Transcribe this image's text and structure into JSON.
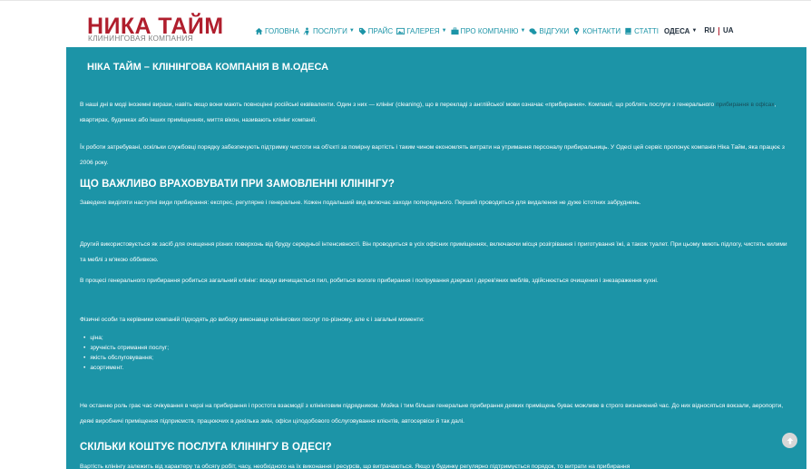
{
  "header": {
    "logo_title": "НИКА ТАЙМ",
    "logo_subtitle": "КЛИНИНГОВАЯ КОМПАНИЯ",
    "nav": [
      {
        "label": "ГОЛОВНА",
        "icon": "home-icon",
        "dropdown": false
      },
      {
        "label": "ПОСЛУГИ",
        "icon": "person-icon",
        "dropdown": true
      },
      {
        "label": "ПРАЙС",
        "icon": "tag-icon",
        "dropdown": false
      },
      {
        "label": "ГАЛЕРЕЯ",
        "icon": "picture-icon",
        "dropdown": true
      },
      {
        "label": "ПРО КОМПАНІЮ",
        "icon": "briefcase-icon",
        "dropdown": true
      },
      {
        "label": "ВІДГУКИ",
        "icon": "comments-icon",
        "dropdown": false
      },
      {
        "label": "КОНТАКТИ",
        "icon": "map-marker-icon",
        "dropdown": false
      },
      {
        "label": "СТАТТІ",
        "icon": "book-icon",
        "dropdown": false
      }
    ],
    "city": "ОДЕСА",
    "lang_ru": "RU",
    "lang_ua": "UA"
  },
  "content": {
    "title": "НІКА ТАЙМ – КЛІНІНГОВА КОМПАНІЯ В М.ОДЕСА",
    "p1_before": "В наші дні в моді іноземні вирази, навіть якщо вони мають повноцінні російські еквіваленти. Один з них — клінінг (cleaning), що в перекладі з англійської мови означає «прибирання». Компанії, що роблять послуги з генерального ",
    "p1_link": "прибирання в офісах",
    "p1_after": ", квартирах, будинках або інших приміщеннях, миття вікон, називають клінінг компанії.",
    "p2": "Їх роботи затребувані, оскільки службовці порядку забезпечують підтримку чистоти на об'єкті за помірну вартість і таким чином економлять витрати на утримання персоналу прибиральниць. У Одесі цей сервіс пропонує компанія Ніка Тайм, яка працює з 2006 року.",
    "h2_1": "ЩО ВАЖЛИВО ВРАХОВУВАТИ ПРИ ЗАМОВЛЕННІ КЛІНІНГУ?",
    "p3": "Заведено виділяти наступні види прибирання: експрес, регулярне і генеральне. Кожен подальший вид включає заходи попереднього. Перший проводиться для видалення не дуже істотних забруднень.",
    "p4": "Другий використовується як засіб для очищення різних поверхонь від бруду середньої інтенсивності. Він проводиться в усіх офісних приміщеннях, включаючи місця розігрівання і приготування їжі, а також туалет. При цьому миють підлогу, чистять килими та меблі з м'якою оббивкою.",
    "p5": "В процесі генерального прибирання робиться загальний клінінг: всюди вичищається пил, робиться вологе прибирання і полірування дзеркал і дерев'яних меблів, здійснюється очищення і знезараження кухні.",
    "p6": "Фізичні особи та керівники компаній підходять до вибору виконавця клінінгових послуг по-різному, але є і загальні моменти:",
    "bullets": [
      "ціна;",
      "зручність отримання послуг;",
      "якість обслуговування;",
      "асортимент."
    ],
    "p7": "Не останню роль грає час очікування в черзі на прибирання і простота взаємодії з клінінговим підрядником. Мойка і тим більше генеральне прибирання деяких приміщень буває можливе в строго визначений час. До них відносяться вокзали, аеропорти, деякі виробничі приміщення підприємств, працюючих в декілька змін, офіси цілодобового обслуговування клієнтів, автосервіси й так далі.",
    "h2_2": "СКІЛЬКИ КОШТУЄ ПОСЛУГА КЛІНІНГУ В ОДЕСІ?",
    "p8": "Вартість клінінгу залежить від характеру та обсягу робіт, часу, необхідного на їх виконання і ресурсів, що витрачаються. Якщо у будинку регулярно підтримується порядок, то витрати на прибирання"
  },
  "colors": {
    "brand_red": "#b01e2d",
    "teal": "#1c94a7",
    "nav_text": "#1c94a7",
    "link_dark": "#1a4e59"
  }
}
